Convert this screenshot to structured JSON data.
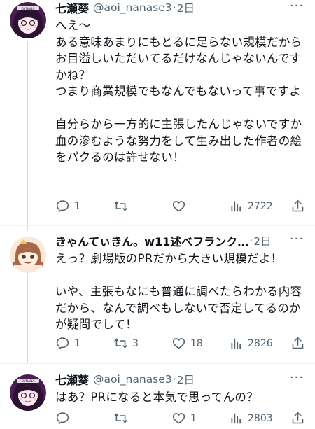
{
  "tweets": [
    {
      "name": "七瀬葵",
      "handle": "@aoi_nanase3",
      "time": "2日",
      "body": "へえ〜\nある意味あまりにもとるに足らない規模だからお目溢しいただいてるだけなんじゃないんですかね？\nつまり商業規模でもなんでもないって事ですよ\n\n自分らから一方的に主張したんじゃないですか\n血の滲むような努力をして生み出した作者の絵をパクるのは許せない！",
      "reply_count": "1",
      "retweet_count": "",
      "like_count": "",
      "view_count": "2722"
    },
    {
      "name": "きゃんてぃきん。w11述べフランク…",
      "handle": "",
      "time": "2日",
      "body": "えっ？劇場版のPRだから大きい規模だよ！\n\nいや、主張もなにも普通に調べたらわかる内容だから、なんで調べもしないで否定してるのかが疑問でして！",
      "reply_count": "1",
      "retweet_count": "3",
      "like_count": "18",
      "view_count": "2826"
    },
    {
      "name": "七瀬葵",
      "handle": "@aoi_nanase3",
      "time": "2日",
      "body": "はあ？PRになると本気で思ってんの？",
      "reply_count": "",
      "retweet_count": "",
      "like_count": "1",
      "view_count": "2803"
    }
  ],
  "separator": "·",
  "more_glyph": "···",
  "colors": {
    "text": "#0f1419",
    "secondary": "#536471",
    "thread_line": "#cfd9de",
    "avatar1_bg": "#4a1d52",
    "avatar2_bg": "#fbe9d7"
  },
  "icons": [
    "reply-icon",
    "retweet-icon",
    "like-icon",
    "views-icon",
    "share-icon"
  ]
}
